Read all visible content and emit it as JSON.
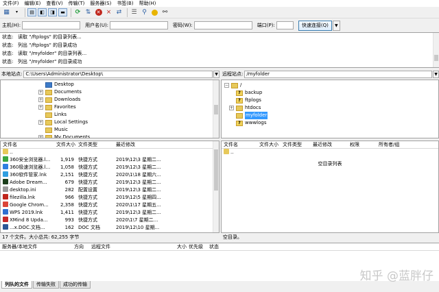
{
  "menu": [
    "文件(F)",
    "编辑(E)",
    "查看(V)",
    "传输(T)",
    "服务器(S)",
    "书签(B)",
    "帮助(H)"
  ],
  "quickconnect": {
    "host_label": "主机(H):",
    "user_label": "用户名(U):",
    "pass_label": "密码(W):",
    "port_label": "端口(P):",
    "connect_label": "快速连接(Q)",
    "dropdown_icon": "chevron-down-icon"
  },
  "log": [
    {
      "key": "状态:",
      "text": "读取 \"/ftplogs\" 的目录列表..."
    },
    {
      "key": "状态:",
      "text": "列出 \"/ftplogs\" 的目录成功"
    },
    {
      "key": "状态:",
      "text": "读取 \"/myfolder\" 的目录列表..."
    },
    {
      "key": "状态:",
      "text": "列出 \"/myfolder\" 的目录成功"
    }
  ],
  "local": {
    "label": "本地站点:",
    "path": "C:\\Users\\Administrator\\Desktop\\",
    "tree": [
      {
        "name": "Desktop",
        "expander": "",
        "icon": "blue"
      },
      {
        "name": "Documents",
        "expander": "+",
        "icon": "yellow"
      },
      {
        "name": "Downloads",
        "expander": "+",
        "icon": "yellow"
      },
      {
        "name": "Favorites",
        "expander": "+",
        "icon": "yellow"
      },
      {
        "name": "Links",
        "expander": "",
        "icon": "yellow"
      },
      {
        "name": "Local Settings",
        "expander": "+",
        "icon": "yellow"
      },
      {
        "name": "Music",
        "expander": "",
        "icon": "yellow"
      },
      {
        "name": "My Documents",
        "expander": "+",
        "icon": "yellow"
      }
    ],
    "columns": [
      "文件名",
      "文件大小",
      "文件类型",
      "最近修改"
    ],
    "files": [
      {
        "name": "..",
        "size": "",
        "type": "",
        "modified": "",
        "color": "#e7c95a"
      },
      {
        "name": "360安全浏览器.l...",
        "size": "1,919",
        "type": "快捷方式",
        "modified": "2019\\12\\3 星期二...",
        "color": "#3aa640"
      },
      {
        "name": "360极速浏览器.l...",
        "size": "1,058",
        "type": "快捷方式",
        "modified": "2019\\12\\3 星期二...",
        "color": "#2f7fe0"
      },
      {
        "name": "360软件管家.lnk",
        "size": "2,151",
        "type": "快捷方式",
        "modified": "2020\\1\\18 星期六...",
        "color": "#2f9ee0"
      },
      {
        "name": "Adobe Dream...",
        "size": "679",
        "type": "快捷方式",
        "modified": "2019\\12\\3 星期二...",
        "color": "#1a3d1a"
      },
      {
        "name": "desktop.ini",
        "size": "282",
        "type": "配置设置",
        "modified": "2019\\12\\3 星期二...",
        "color": "#9a9a9a"
      },
      {
        "name": "filezilla.lnk",
        "size": "966",
        "type": "快捷方式",
        "modified": "2019\\12\\5 星期四...",
        "color": "#c0261c"
      },
      {
        "name": "Google Chrom...",
        "size": "2,358",
        "type": "快捷方式",
        "modified": "2020\\1\\17 星期五...",
        "color": "#db4437"
      },
      {
        "name": "WPS 2019.lnk",
        "size": "1,411",
        "type": "快捷方式",
        "modified": "2019\\12\\3 星期二...",
        "color": "#2f6fd0"
      },
      {
        "name": "XMind 8 Upda...",
        "size": "993",
        "type": "快捷方式",
        "modified": "2020\\1\\7 星期二...",
        "color": "#c62828"
      },
      {
        "name": "...x.DOC.文档...",
        "size": "162",
        "type": "DOC 文档",
        "modified": "2019\\12\\10 星期...",
        "color": "#2b5797"
      }
    ],
    "status": "17 个文件。大小总共: 62,255 字节"
  },
  "remote": {
    "label": "远程站点:",
    "path": "/myfolder",
    "tree": [
      {
        "name": "/",
        "expander": "−",
        "icon": "yellow",
        "indent": 0
      },
      {
        "name": "backup",
        "expander": "",
        "icon": "question",
        "indent": 1
      },
      {
        "name": "ftplogs",
        "expander": "",
        "icon": "question",
        "indent": 1
      },
      {
        "name": "htdocs",
        "expander": "+",
        "icon": "yellow",
        "indent": 1
      },
      {
        "name": "myfolder",
        "expander": "",
        "icon": "yellow",
        "indent": 1,
        "selected": true
      },
      {
        "name": "wwwlogs",
        "expander": "",
        "icon": "question",
        "indent": 1
      }
    ],
    "columns": [
      "文件名",
      "文件大小",
      "文件类型",
      "最近修改",
      "权限",
      "所有者/组"
    ],
    "parent_entry": "..",
    "empty_text": "空目录列表",
    "status": "空目录。"
  },
  "queue": {
    "columns": [
      "服务器/本地文件",
      "方向",
      "远程文件",
      "大小",
      "优先级",
      "状态"
    ]
  },
  "tabs": [
    "列队的文件",
    "传输失败",
    "成功的传输"
  ],
  "watermark": "知乎 @蓝胖仔",
  "colors": {
    "selected_bg": "#3399ff",
    "connect_border": "#3c7fb1"
  }
}
